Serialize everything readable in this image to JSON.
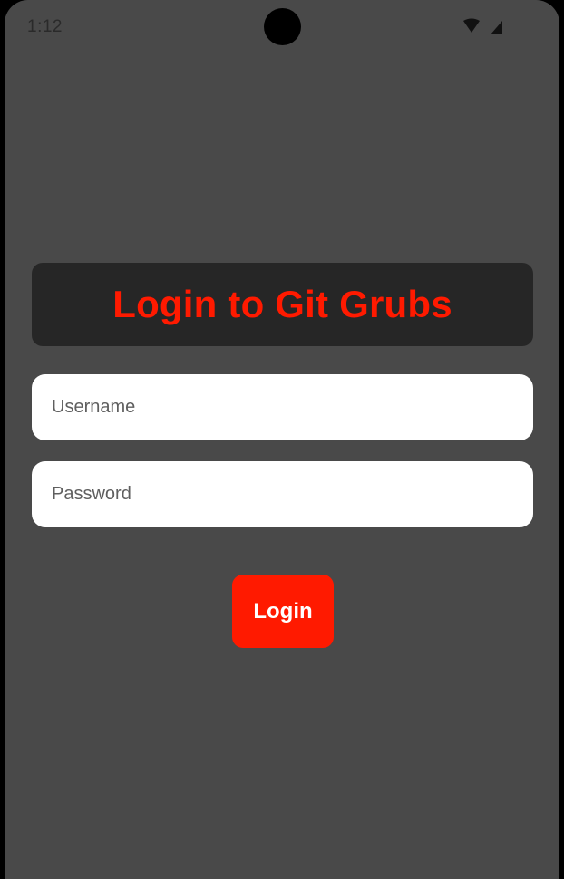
{
  "status_bar": {
    "time": "1:12",
    "icons": [
      "wifi-icon",
      "cellular-signal-icon"
    ]
  },
  "login": {
    "title": "Login to Git Grubs",
    "username_placeholder": "Username",
    "password_placeholder": "Password",
    "button_label": "Login"
  },
  "colors": {
    "background": "#494949",
    "title_card": "#262626",
    "accent": "#ff1a00",
    "input_background": "#ffffff"
  }
}
